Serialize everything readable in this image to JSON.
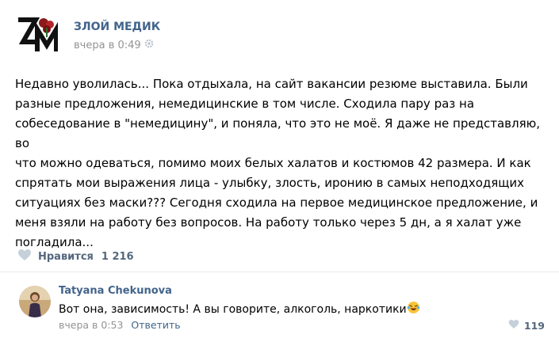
{
  "post": {
    "group_name": "ЗЛОЙ МЕДИК",
    "time": "вчера в 0:49",
    "text_lines": [
      "Недавно уволилась... Пока отдыхала, на сайт вакансии резюме выставила. Были",
      "разные предложения, немедицинские в том числе. Сходила пару раз на",
      "собеседование в \"немедицину\", и поняла, что это не моё. Я даже не представляю, во",
      "что можно одеваться, помимо моих белых халатов и костюмов 42 размера. И как",
      "спрятать мои выражения лица - улыбку, злость, иронию в самых неподходящих",
      "ситуациях без маски??? Сегодня сходила на первое медицинское предложение, и",
      "меня взяли на работу без вопросов. На работу только через 5 дн, а я халат уже",
      "погладила..."
    ],
    "likes_label": "Нравится",
    "likes_count": "1 216"
  },
  "comment": {
    "author": "Tatyana Chekunova",
    "text": "Вот она, зависимость! А вы говорите, алкоголь, наркотики",
    "time": "вчера в 0:53",
    "reply_label": "Ответить",
    "likes_count": "119"
  },
  "colors": {
    "link": "#42648b",
    "muted": "#939393",
    "like_icon": "#c5d0db",
    "divider": "#e7e8ec"
  },
  "icons": {
    "gear": "gear-icon",
    "heart": "heart-icon",
    "emoji": "laughing-emoji-icon"
  }
}
